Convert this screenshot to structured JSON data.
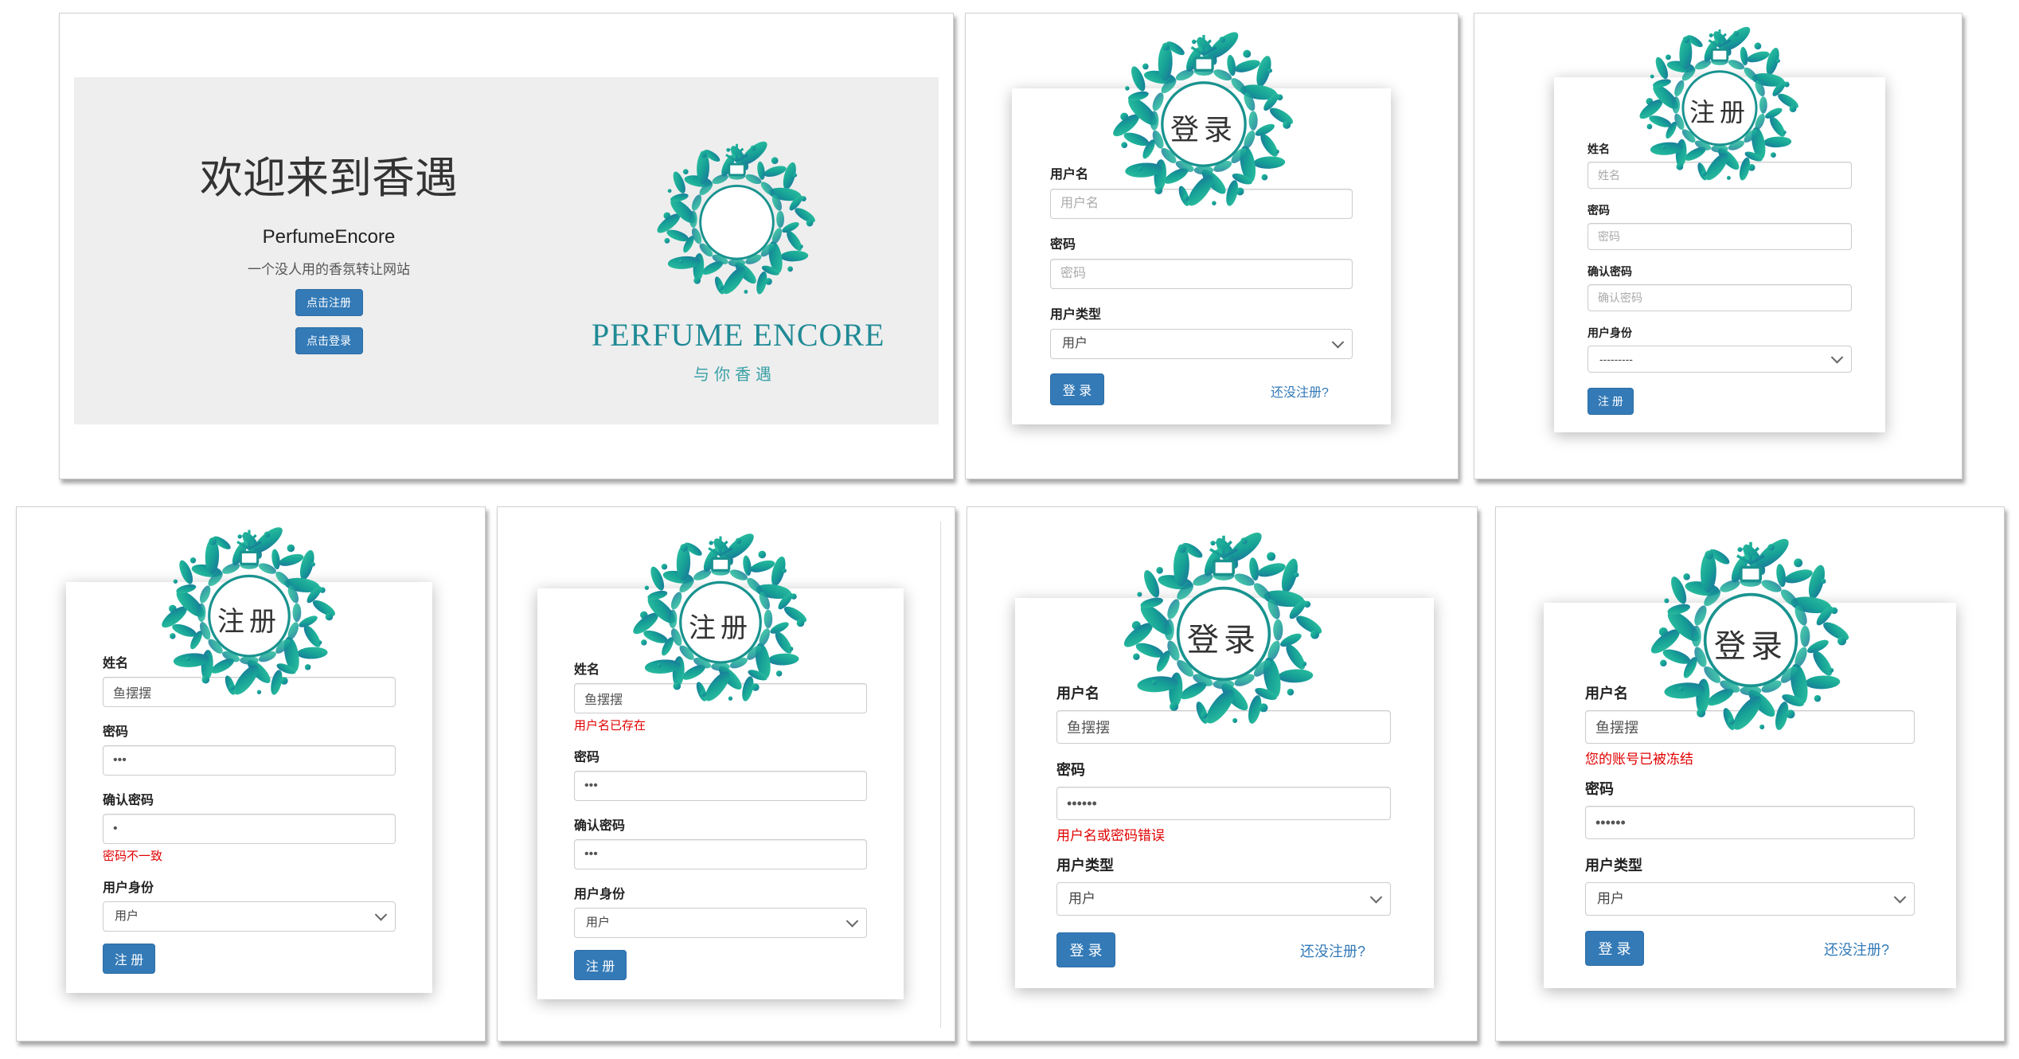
{
  "welcome_panel": {
    "title": "欢迎来到香遇",
    "subtitle": "PerfumeEncore",
    "tagline": "一个没人用的香氛转让网站",
    "register_button": "点击注册",
    "login_button": "点击登录",
    "brand_name": "PERFUME ENCORE",
    "brand_slogan": "与你香遇"
  },
  "login_empty": {
    "heading": "登录",
    "username_label": "用户名",
    "username_placeholder": "用户名",
    "password_label": "密码",
    "password_placeholder": "密码",
    "usertype_label": "用户类型",
    "usertype_value": "用户",
    "submit": "登 录",
    "register_link": "还没注册?"
  },
  "register_empty": {
    "heading": "注册",
    "name_label": "姓名",
    "name_placeholder": "姓名",
    "password_label": "密码",
    "password_placeholder": "密码",
    "confirm_label": "确认密码",
    "confirm_placeholder": "确认密码",
    "identity_label": "用户身份",
    "identity_value": "---------",
    "submit": "注 册"
  },
  "register_mismatch": {
    "heading": "注册",
    "name_label": "姓名",
    "name_value": "鱼摆摆",
    "password_label": "密码",
    "password_value": "•••",
    "confirm_label": "确认密码",
    "confirm_value": "•",
    "error": "密码不一致",
    "identity_label": "用户身份",
    "identity_value": "用户",
    "submit": "注 册"
  },
  "register_exists": {
    "heading": "注册",
    "name_label": "姓名",
    "name_value": "鱼摆摆",
    "error": "用户名已存在",
    "password_label": "密码",
    "password_value": "•••",
    "confirm_label": "确认密码",
    "confirm_value": "•••",
    "identity_label": "用户身份",
    "identity_value": "用户",
    "submit": "注 册"
  },
  "login_wrong": {
    "heading": "登录",
    "username_label": "用户名",
    "username_value": "鱼摆摆",
    "password_label": "密码",
    "password_value": "••••••",
    "error": "用户名或密码错误",
    "usertype_label": "用户类型",
    "usertype_value": "用户",
    "submit": "登 录",
    "register_link": "还没注册?"
  },
  "login_frozen": {
    "heading": "登录",
    "username_label": "用户名",
    "username_value": "鱼摆摆",
    "error": "您的账号已被冻结",
    "password_label": "密码",
    "password_value": "••••••",
    "usertype_label": "用户类型",
    "usertype_value": "用户",
    "submit": "登 录",
    "register_link": "还没注册?"
  },
  "colors": {
    "primary": "#337ab7",
    "error": "#e00000",
    "brand_teal": "#1f8a95",
    "jumbotron": "#eeeeee"
  },
  "icons": [
    "perfume-wreath-icon",
    "chevron-down-icon"
  ]
}
